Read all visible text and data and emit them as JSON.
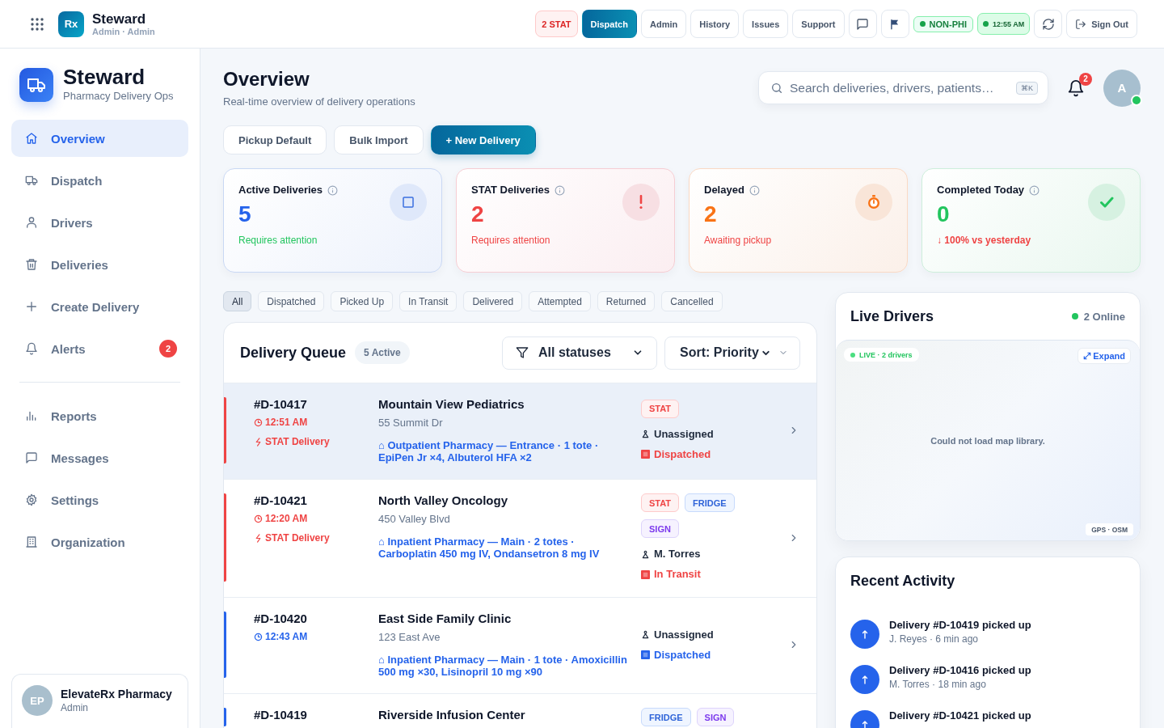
{
  "topbar": {
    "logo": "Rx",
    "title": "Steward",
    "subtitle": "Admin · Admin",
    "stat_alert": "2 STAT",
    "nav": [
      {
        "label": "Dispatch",
        "selected": true
      },
      {
        "label": "Admin",
        "selected": false
      },
      {
        "label": "History",
        "selected": false
      },
      {
        "label": "Issues",
        "selected": false
      },
      {
        "label": "Support",
        "selected": false
      }
    ],
    "phi_status": "NON-PHI",
    "clock": "12:55 AM",
    "sign_out": "Sign Out"
  },
  "sidebar": {
    "brand": "Steward",
    "tagline": "Pharmacy Delivery Ops",
    "groups": [
      [
        {
          "label": "Overview",
          "selected": true
        },
        {
          "label": "Dispatch",
          "selected": false
        },
        {
          "label": "Drivers",
          "selected": false
        },
        {
          "label": "Deliveries",
          "selected": false
        },
        {
          "label": "Create Delivery",
          "selected": false
        },
        {
          "label": "Alerts",
          "selected": false,
          "badge": "2"
        }
      ],
      [
        {
          "label": "Reports",
          "selected": false
        },
        {
          "label": "Messages",
          "selected": false
        },
        {
          "label": "Settings",
          "selected": false
        },
        {
          "label": "Organization",
          "selected": false
        }
      ]
    ],
    "account": {
      "initials": "EP",
      "name": "ElevateRx Pharmacy",
      "role": "Admin"
    }
  },
  "header": {
    "title": "Overview",
    "subtitle": "Real-time overview of delivery operations",
    "search": {
      "placeholder": "Search deliveries, drivers, patients…",
      "shortcut": "⌘K"
    },
    "notifications": "2",
    "avatar": "A",
    "online": true
  },
  "actions": [
    {
      "label": "Pickup Default",
      "kind": "secondary"
    },
    {
      "label": "Bulk Import",
      "kind": "secondary"
    },
    {
      "label": "+ New Delivery",
      "kind": "primary"
    }
  ],
  "stats": [
    {
      "kind": "active",
      "title": "Active Deliveries",
      "value": "5",
      "note": "Requires attention"
    },
    {
      "kind": "stat",
      "title": "STAT Deliveries",
      "value": "2",
      "note": "Requires attention"
    },
    {
      "kind": "delayed",
      "title": "Delayed",
      "value": "2",
      "note": "Awaiting pickup"
    },
    {
      "kind": "completed",
      "title": "Completed Today",
      "value": "0",
      "note": "↓ 100% vs yesterday"
    }
  ],
  "filters": [
    {
      "label": "All",
      "selected": true
    },
    {
      "label": "Dispatched",
      "selected": false
    },
    {
      "label": "Picked Up",
      "selected": false
    },
    {
      "label": "In Transit",
      "selected": false
    },
    {
      "label": "Delivered",
      "selected": false
    },
    {
      "label": "Attempted",
      "selected": false
    },
    {
      "label": "Returned",
      "selected": false
    },
    {
      "label": "Cancelled",
      "selected": false
    }
  ],
  "queue": {
    "title": "Delivery Queue",
    "count": "5 Active",
    "status_filter": "All statuses",
    "sort": "Sort: Priority",
    "rows": [
      {
        "id": "#D-10417",
        "time": "12:51 AM",
        "priority": "STAT Delivery",
        "stat": true,
        "selected": true,
        "name": "Mountain View Pediatrics",
        "address": "55 Summit Dr",
        "details": "⌂ Outpatient Pharmacy — Entrance · 1 tote · EpiPen Jr ×4, Albuterol HFA ×2",
        "tags": [
          {
            "label": "STAT",
            "kind": "stat"
          }
        ],
        "driver": "Unassigned",
        "status": "Dispatched"
      },
      {
        "id": "#D-10421",
        "time": "12:20 AM",
        "priority": "STAT Delivery",
        "stat": true,
        "selected": false,
        "name": "North Valley Oncology",
        "address": "450 Valley Blvd",
        "details": "⌂ Inpatient Pharmacy — Main · 2 totes · Carboplatin 450 mg IV, Ondansetron 8 mg IV",
        "tags": [
          {
            "label": "STAT",
            "kind": "stat"
          },
          {
            "label": "FRIDGE",
            "kind": "fridge"
          },
          {
            "label": "SIGN",
            "kind": "sign"
          }
        ],
        "driver": "M. Torres",
        "status": "In Transit"
      },
      {
        "id": "#D-10420",
        "time": "12:43 AM",
        "stat": false,
        "selected": false,
        "name": "East Side Family Clinic",
        "address": "123 East Ave",
        "details": "⌂ Inpatient Pharmacy — Main · 1 tote · Amoxicillin 500 mg ×30, Lisinopril 10 mg ×90",
        "driver": "Unassigned",
        "status": "Dispatched"
      },
      {
        "id": "#D-10419",
        "stat": false,
        "selected": false,
        "name": "Riverside Infusion Center",
        "tags": [
          {
            "label": "FRIDGE",
            "kind": "fridge"
          },
          {
            "label": "SIGN",
            "kind": "sign"
          }
        ]
      }
    ]
  },
  "live_drivers": {
    "title": "Live Drivers",
    "online": "2 Online",
    "map": {
      "live": "LIVE · 2 drivers",
      "expand": "Expand",
      "message": "Could not load map library.",
      "attribution": "GPS · OSM"
    }
  },
  "recent_activity": {
    "title": "Recent Activity",
    "items": [
      {
        "title": "Delivery #D-10419 picked up",
        "meta": "J. Reyes · 6 min ago"
      },
      {
        "title": "Delivery #D-10416 picked up",
        "meta": "M. Torres · 18 min ago"
      },
      {
        "title": "Delivery #D-10421 picked up"
      }
    ]
  }
}
